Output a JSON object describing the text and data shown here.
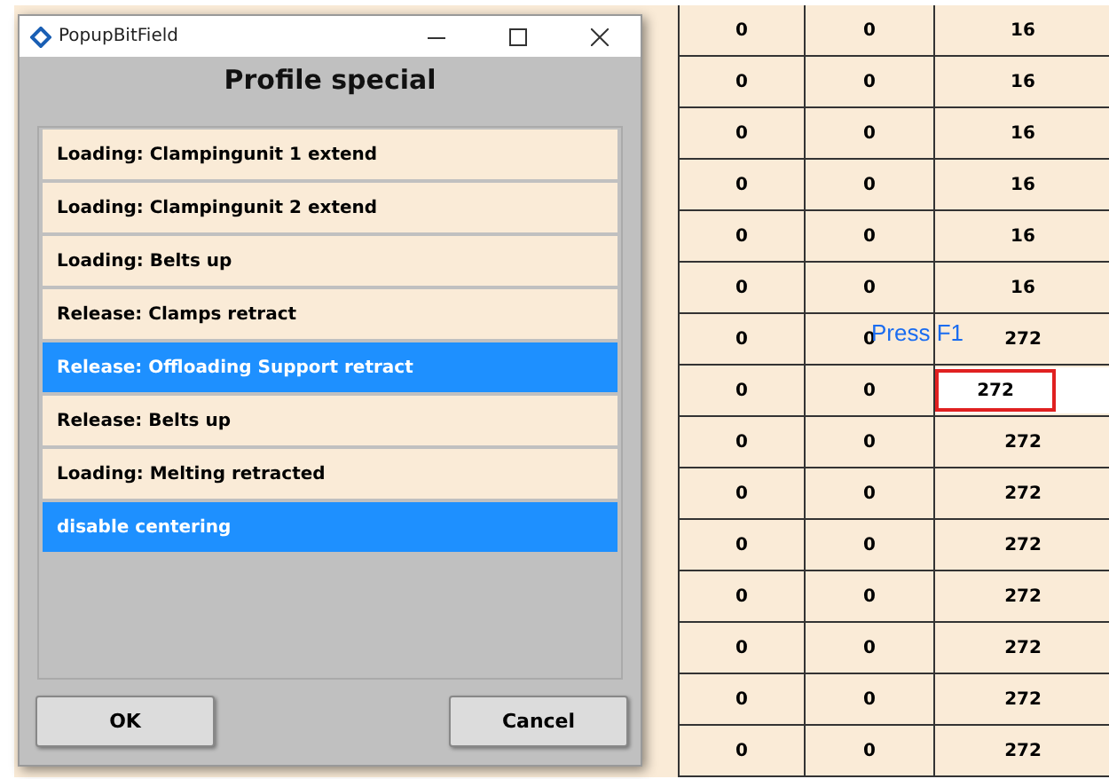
{
  "table": {
    "rows": [
      {
        "cells": [
          "0",
          "0",
          "16"
        ],
        "editing": false
      },
      {
        "cells": [
          "0",
          "0",
          "16"
        ],
        "editing": false
      },
      {
        "cells": [
          "0",
          "0",
          "16"
        ],
        "editing": false
      },
      {
        "cells": [
          "0",
          "0",
          "16"
        ],
        "editing": false
      },
      {
        "cells": [
          "0",
          "0",
          "16"
        ],
        "editing": false
      },
      {
        "cells": [
          "0",
          "0",
          "16"
        ],
        "editing": false
      },
      {
        "cells": [
          "0",
          "0",
          "272"
        ],
        "editing": false
      },
      {
        "cells": [
          "0",
          "0",
          "272"
        ],
        "editing": true
      },
      {
        "cells": [
          "0",
          "0",
          "272"
        ],
        "editing": false
      },
      {
        "cells": [
          "0",
          "0",
          "272"
        ],
        "editing": false
      },
      {
        "cells": [
          "0",
          "0",
          "272"
        ],
        "editing": false
      },
      {
        "cells": [
          "0",
          "0",
          "272"
        ],
        "editing": false
      },
      {
        "cells": [
          "0",
          "0",
          "272"
        ],
        "editing": false
      },
      {
        "cells": [
          "0",
          "0",
          "272"
        ],
        "editing": false
      },
      {
        "cells": [
          "0",
          "0",
          "272"
        ],
        "editing": false
      }
    ]
  },
  "tooltip": {
    "text": "Press F1"
  },
  "dialog": {
    "title": "PopupBitField",
    "heading": "Profile special",
    "items": [
      {
        "label": "Loading: Clampingunit 1 extend",
        "selected": false
      },
      {
        "label": "Loading: Clampingunit 2 extend",
        "selected": false
      },
      {
        "label": "Loading: Belts up",
        "selected": false
      },
      {
        "label": "Release: Clamps retract",
        "selected": false
      },
      {
        "label": "Release: Offloading Support retract",
        "selected": true
      },
      {
        "label": "Release: Belts up",
        "selected": false
      },
      {
        "label": "Loading: Melting retracted",
        "selected": false
      },
      {
        "label": "disable centering",
        "selected": true
      }
    ],
    "buttons": [
      "OK",
      "Cancel"
    ]
  }
}
